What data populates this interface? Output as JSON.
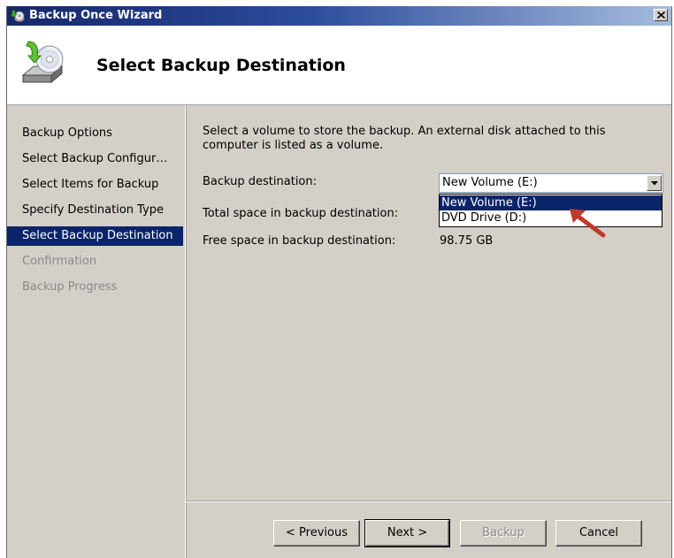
{
  "window": {
    "title": "Backup Once Wizard"
  },
  "header": {
    "title": "Select Backup Destination"
  },
  "nav": {
    "items": [
      {
        "label": "Backup Options",
        "state": "normal"
      },
      {
        "label": "Select Backup Configur…",
        "state": "normal"
      },
      {
        "label": "Select Items for Backup",
        "state": "normal"
      },
      {
        "label": "Specify Destination Type",
        "state": "normal"
      },
      {
        "label": "Select Backup Destination",
        "state": "selected"
      },
      {
        "label": "Confirmation",
        "state": "disabled"
      },
      {
        "label": "Backup Progress",
        "state": "disabled"
      }
    ]
  },
  "content": {
    "description": "Select a volume to store the backup. An external disk attached to this computer is listed as a volume.",
    "destination_label": "Backup destination:",
    "destination_value": "New Volume (E:)",
    "dropdown_options": [
      "New Volume (E:)",
      "DVD Drive (D:)"
    ],
    "total_space_label": "Total space in backup destination:",
    "free_space_label": "Free space in backup destination:",
    "free_space_value": "98.75 GB"
  },
  "buttons": {
    "previous": "< Previous",
    "next": "Next >",
    "backup": "Backup",
    "cancel": "Cancel"
  },
  "icons": {
    "title": "backup-wizard-icon",
    "header": "backup-disk-icon",
    "close": "close-icon",
    "dropdown": "chevron-down-icon",
    "annotation": "red-arrow-annotation"
  },
  "colors": {
    "selection": "#0a246a",
    "annotation": "#c0392b"
  }
}
